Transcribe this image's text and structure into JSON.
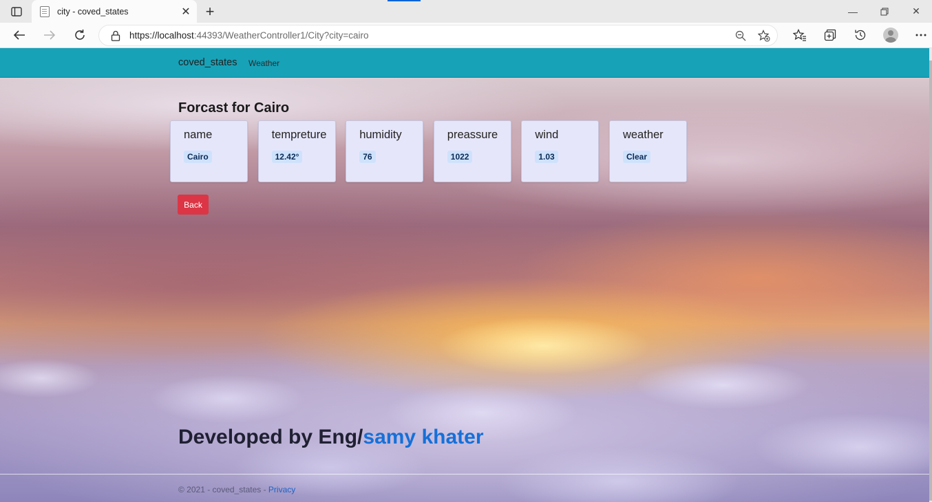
{
  "browser": {
    "tab_title": "city - coved_states",
    "url_host": "https://localhost",
    "url_rest": ":44393/WeatherController1/City?city=cairo"
  },
  "navbar": {
    "brand": "coved_states",
    "link": "Weather"
  },
  "page": {
    "heading": "Forcast for Cairo",
    "cards": [
      {
        "label": "name",
        "value": "Cairo"
      },
      {
        "label": "tempreture",
        "value": "12.42°"
      },
      {
        "label": "humidity",
        "value": "76"
      },
      {
        "label": "preassure",
        "value": "1022"
      },
      {
        "label": "wind",
        "value": "1.03"
      },
      {
        "label": "weather",
        "value": "Clear"
      }
    ],
    "back_label": "Back",
    "developed_by": "Developed by Eng/",
    "developer_name": "samy khater"
  },
  "footer": {
    "copyright": "© 2021 - coved_states - ",
    "privacy": "Privacy"
  },
  "colors": {
    "navbar": "#17a2b8",
    "back_button": "#dc3545",
    "card_bg": "#e6e6fb",
    "badge_bg": "#cfe2fc",
    "link": "#1670d8"
  }
}
